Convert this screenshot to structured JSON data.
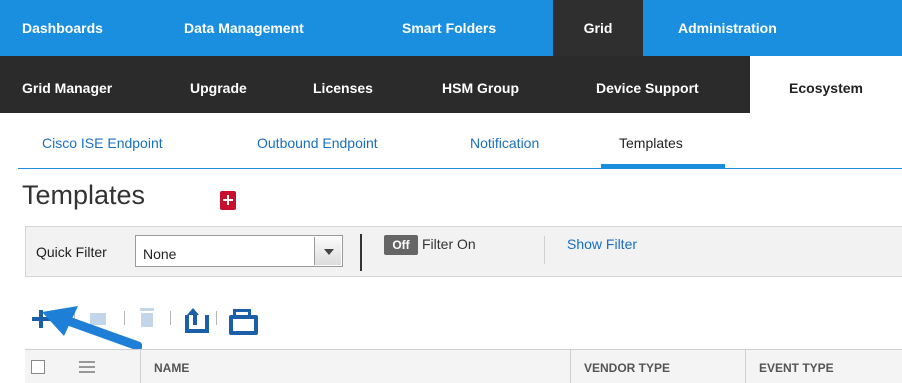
{
  "top_nav": {
    "tabs": [
      {
        "label": "Dashboards"
      },
      {
        "label": "Data Management"
      },
      {
        "label": "Smart Folders"
      },
      {
        "label": "Grid"
      },
      {
        "label": "Administration"
      }
    ],
    "active": "Grid"
  },
  "sub_nav": {
    "tabs": [
      {
        "label": "Grid Manager"
      },
      {
        "label": "Upgrade"
      },
      {
        "label": "Licenses"
      },
      {
        "label": "HSM Group"
      },
      {
        "label": "Device Support"
      },
      {
        "label": "Ecosystem"
      }
    ],
    "active": "Ecosystem"
  },
  "eco_tabs": {
    "tabs": [
      {
        "label": "Cisco ISE Endpoint"
      },
      {
        "label": "Outbound Endpoint"
      },
      {
        "label": "Notification"
      },
      {
        "label": "Templates"
      }
    ],
    "active": "Templates"
  },
  "page": {
    "title": "Templates"
  },
  "filter_bar": {
    "quick_filter_label": "Quick Filter",
    "quick_filter_value": "None",
    "toggle_label": "Off",
    "filter_on_label": "Filter On",
    "show_filter_label": "Show Filter"
  },
  "table": {
    "columns": [
      {
        "label": "NAME"
      },
      {
        "label": "VENDOR TYPE"
      },
      {
        "label": "EVENT TYPE"
      }
    ]
  },
  "icons": {
    "add": "plus-icon",
    "edit": "edit-icon",
    "delete": "trash-icon",
    "export": "export-icon",
    "print": "print-icon",
    "bookmark": "bookmark-icon"
  },
  "colors": {
    "top_nav_bg": "#1a8fe0",
    "sub_nav_bg": "#2b2b2b",
    "active_dark": "#2f2f2f",
    "link": "#1a6fc0",
    "toolbar_icon": "#1a5fa8",
    "bookmark": "#c8102e"
  }
}
